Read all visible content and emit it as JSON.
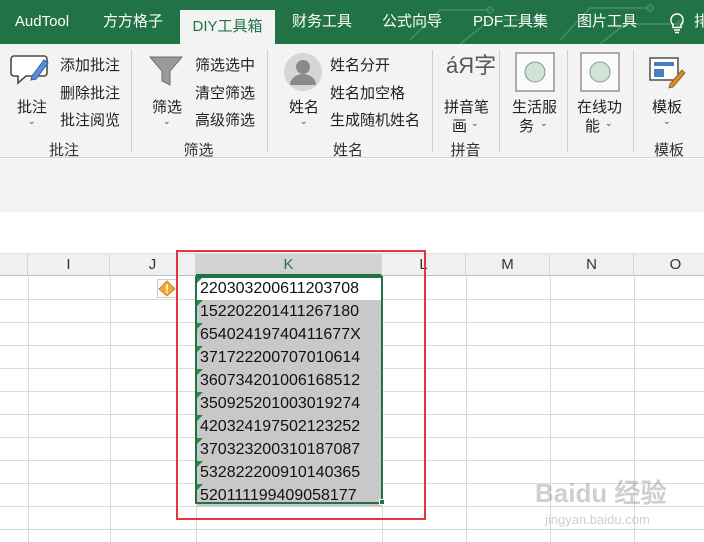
{
  "tabs": [
    {
      "label": "AudTool",
      "active": false
    },
    {
      "label": "方方格子",
      "active": false
    },
    {
      "label": "DIY工具箱",
      "active": true
    },
    {
      "label": "财务工具",
      "active": false
    },
    {
      "label": "公式向导",
      "active": false
    },
    {
      "label": "PDF工具集",
      "active": false
    },
    {
      "label": "图片工具",
      "active": false
    },
    {
      "label": "排",
      "active": false
    }
  ],
  "ribbon": {
    "annotate": {
      "big_label": "批注",
      "items": [
        "添加批注",
        "删除批注",
        "批注阅览"
      ],
      "group_label": "批注"
    },
    "filter": {
      "big_label": "筛选",
      "items": [
        "筛选选中",
        "清空筛选",
        "高级筛选"
      ],
      "group_label": "筛选"
    },
    "name": {
      "big_label": "姓名",
      "items": [
        "姓名分开",
        "姓名加空格",
        "生成随机姓名"
      ],
      "group_label": "姓名"
    },
    "pinyin": {
      "big_label_1": "拼音笔",
      "big_label_2": "画",
      "group_label": "拼音",
      "icon_text": "áЯ字"
    },
    "life": {
      "label_1": "生活服",
      "label_2": "务"
    },
    "online": {
      "label_1": "在线功",
      "label_2": "能"
    },
    "template": {
      "big_label": "模板",
      "group_label": "模板"
    }
  },
  "columns": [
    {
      "label": "I",
      "selected": false
    },
    {
      "label": "J",
      "selected": false
    },
    {
      "label": "K",
      "selected": true
    },
    {
      "label": "L",
      "selected": false
    },
    {
      "label": "M",
      "selected": false
    },
    {
      "label": "N",
      "selected": false
    },
    {
      "label": "O",
      "selected": false
    }
  ],
  "cells": [
    "220303200611203708",
    "152202201411267180",
    "65402419740411677X",
    "371722200707010614",
    "360734201006168512",
    "350925201003019274",
    "420324197502123252",
    "370323200310187087",
    "532822200910140365",
    "520111199409058177"
  ],
  "watermark": {
    "text_1": "Baidu 经验",
    "text_2": "jingyan.baidu.com"
  },
  "colors": {
    "excel_green": "#217346",
    "highlight_red": "#e0363e",
    "selection_gray": "#c8c8c8"
  }
}
